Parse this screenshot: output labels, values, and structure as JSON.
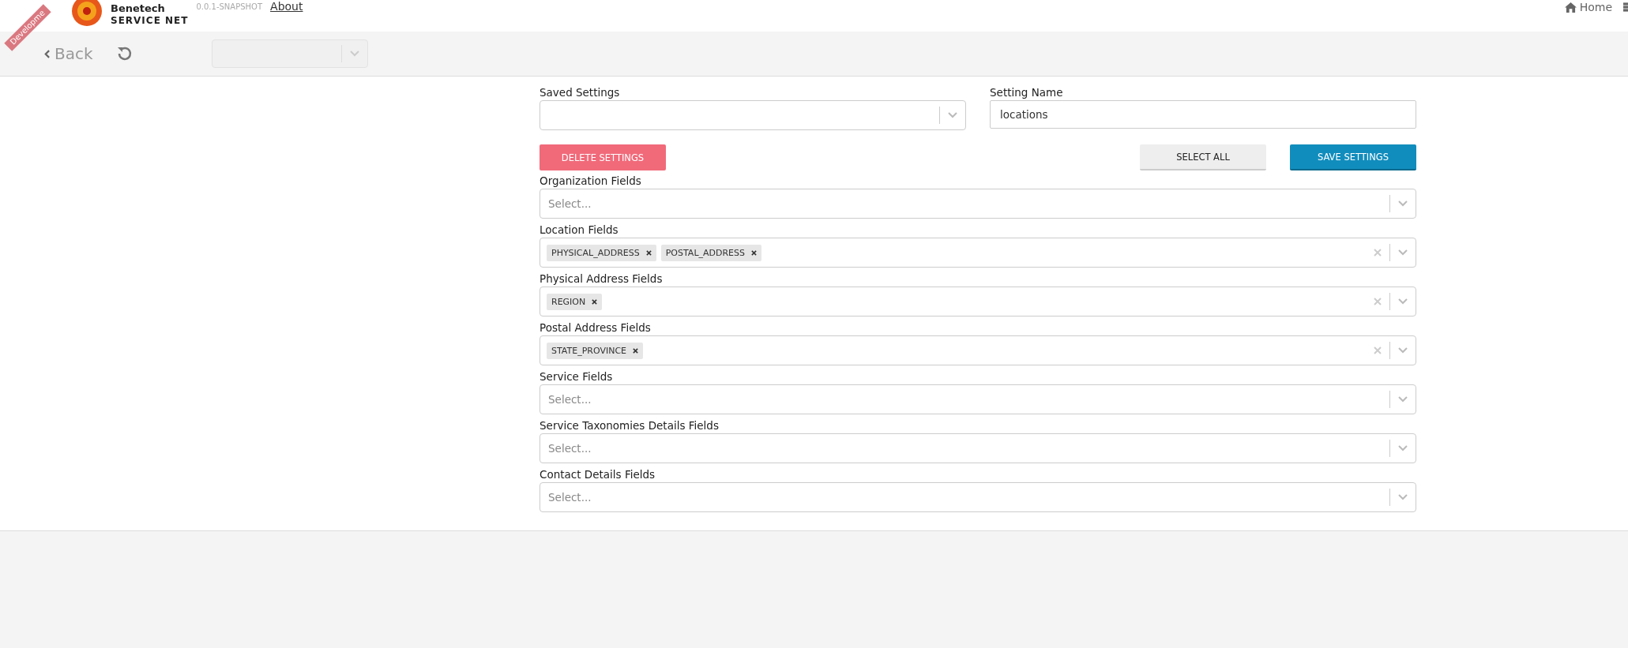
{
  "header": {
    "logo_top": "Benetech",
    "logo_bottom": "SERVICE NET",
    "version": "0.0.1-SNAPSHOT",
    "about_link": "About",
    "home_link": "Home",
    "ribbon": "Developme"
  },
  "toolbar": {
    "back": "Back"
  },
  "settings": {
    "saved_label": "Saved Settings",
    "name_label": "Setting Name",
    "name_value": "locations"
  },
  "buttons": [
    {
      "label": "DELETE SETTINGS",
      "kind": "danger"
    },
    {
      "label": "SELECT ALL",
      "kind": "plain"
    },
    {
      "label": "SAVE SETTINGS",
      "kind": "primary"
    }
  ],
  "fields": [
    {
      "label": "Organization Fields",
      "placeholder": "Select..."
    },
    {
      "label": "Location Fields",
      "tags": [
        "PHYSICAL_ADDRESS",
        "POSTAL_ADDRESS"
      ]
    },
    {
      "label": "Physical Address Fields",
      "tags": [
        "REGION"
      ]
    },
    {
      "label": "Postal Address Fields",
      "tags": [
        "STATE_PROVINCE"
      ]
    },
    {
      "label": "Service Fields",
      "placeholder": "Select..."
    },
    {
      "label": "Service Taxonomies Details Fields",
      "placeholder": "Select..."
    },
    {
      "label": "Contact Details Fields",
      "placeholder": "Select..."
    }
  ]
}
